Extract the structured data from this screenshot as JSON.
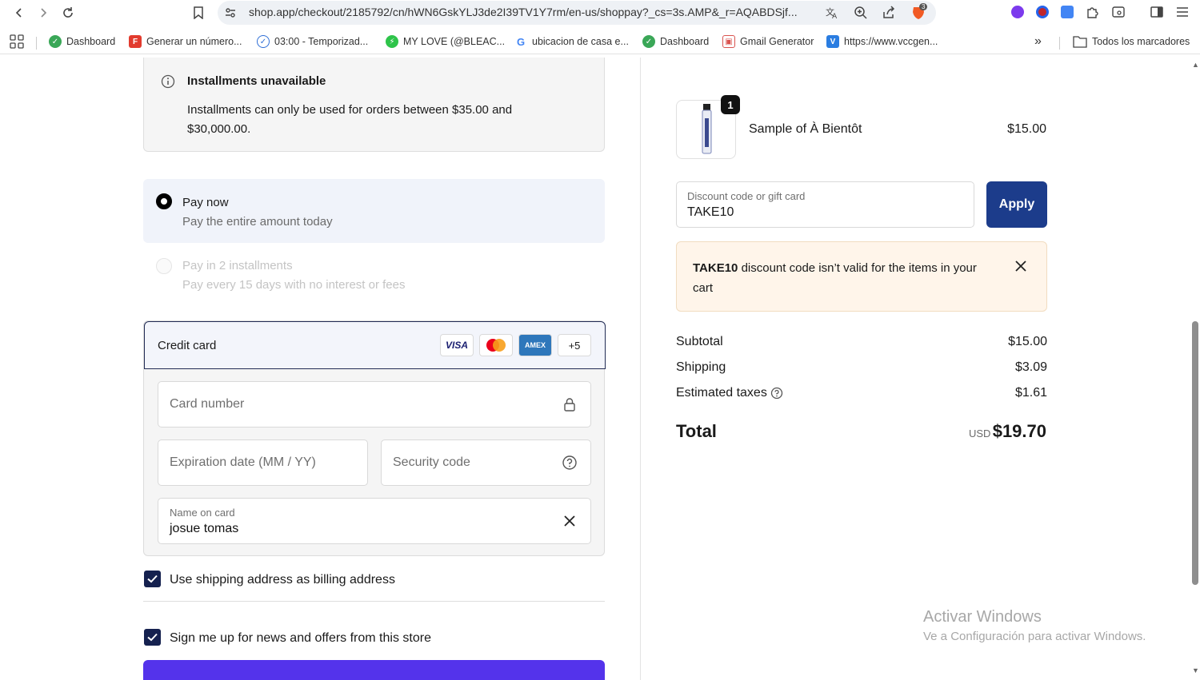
{
  "browser": {
    "url": "shop.app/checkout/2185792/cn/hWN6GskYLJ3de2I39TV1Y7rm/en-us/shoppay?_cs=3s.AMP&_r=AQABDSjf...",
    "bookmarks": [
      {
        "label": "Dashboard",
        "icon": "dashboard-icon",
        "color": "#3aa757"
      },
      {
        "label": "Generar un número...",
        "icon": "f-logo-icon",
        "color": "#e23b2e"
      },
      {
        "label": "03:00 - Temporizad...",
        "icon": "timer-icon",
        "color": "#2f6fd6"
      },
      {
        "label": "MY LOVE (@BLEAC...",
        "icon": "bolt-icon",
        "color": "#2ec44a"
      },
      {
        "label": "ubicacion de casa e...",
        "icon": "google-icon",
        "color": "#4285f4"
      },
      {
        "label": "Dashboard",
        "icon": "dashboard-icon",
        "color": "#3aa757"
      },
      {
        "label": "Gmail Generator",
        "icon": "gmail-generator-icon",
        "color": "#d9534f"
      },
      {
        "label": "https://www.vccgen...",
        "icon": "vcc-icon",
        "color": "#2a7de1"
      }
    ],
    "more_bookmarks": "»",
    "all_bookmarks": "Todos los marcadores",
    "brave_badge": "3"
  },
  "installments_notice": {
    "title": "Installments unavailable",
    "text": "Installments can only be used for orders between $35.00 and $30,000.00."
  },
  "payment_options": {
    "pay_now": {
      "title": "Pay now",
      "subtitle": "Pay the entire amount today"
    },
    "pay_installments": {
      "title": "Pay in 2 installments",
      "subtitle": "Pay every 15 days with no interest or fees"
    }
  },
  "credit_card": {
    "title": "Credit card",
    "brands": [
      "VISA",
      "mastercard",
      "AMEX",
      "+5"
    ],
    "card_number_placeholder": "Card number",
    "expiration_placeholder": "Expiration date (MM / YY)",
    "security_placeholder": "Security code",
    "name_label": "Name on card",
    "name_value": "josue tomas"
  },
  "checkboxes": {
    "billing": "Use shipping address as billing address",
    "newsletter": "Sign me up for news and offers from this store"
  },
  "summary": {
    "product_name": "Sample of À Bientôt",
    "product_qty": "1",
    "product_price": "$15.00",
    "discount_label": "Discount code or gift card",
    "discount_value": "TAKE10",
    "apply": "Apply",
    "warning_code": "TAKE10",
    "warning_text": " discount code isn’t valid for the items in your cart",
    "subtotal_label": "Subtotal",
    "subtotal": "$15.00",
    "shipping_label": "Shipping",
    "shipping": "$3.09",
    "taxes_label": "Estimated taxes",
    "taxes": "$1.61",
    "total_label": "Total",
    "currency": "USD",
    "total": "$19.70"
  },
  "watermark": {
    "line1": "Activar Windows",
    "line2": "Ve a Configuración para activar Windows."
  },
  "colors": {
    "accent": "#1c3c8b",
    "pay_button": "#5433eb",
    "warning_bg": "#fff5ea"
  }
}
